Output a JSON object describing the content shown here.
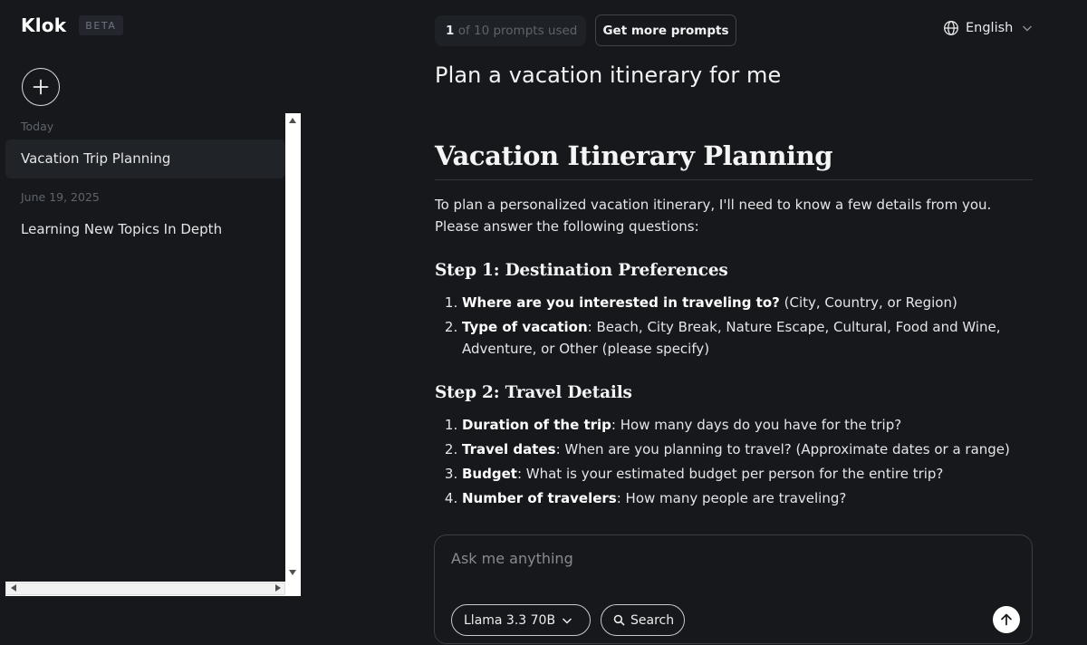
{
  "brand": {
    "name": "Klok",
    "badge": "BETA"
  },
  "sidebar": {
    "new_chat_icon": "plus-icon",
    "history": [
      {
        "group": "Today",
        "items": [
          {
            "label": "Vacation Trip Planning",
            "active": true
          }
        ]
      },
      {
        "group": "June 19, 2025",
        "items": [
          {
            "label": "Learning New Topics In Depth",
            "active": false
          }
        ]
      }
    ]
  },
  "topbar": {
    "usage_used": "1",
    "usage_rest": " of 10 prompts used",
    "more_prompts_label": "Get more prompts",
    "language": "English",
    "language_icon": "globe-icon"
  },
  "conversation": {
    "prompt": "Plan a vacation itinerary for me",
    "answer": {
      "title": "Vacation Itinerary Planning",
      "intro": "To plan a personalized vacation itinerary, I'll need to know a few details from you. Please answer the following questions:",
      "sections": [
        {
          "heading": "Step 1: Destination Preferences",
          "items": [
            {
              "bold": "Where are you interested in traveling to?",
              "text": " (City, Country, or Region)"
            },
            {
              "bold": "Type of vacation",
              "text": ": Beach, City Break, Nature Escape, Cultural, Food and Wine, Adventure, or Other (please specify)"
            }
          ]
        },
        {
          "heading": "Step 2: Travel Details",
          "items": [
            {
              "bold": "Duration of the trip",
              "text": ": How many days do you have for the trip?"
            },
            {
              "bold": "Travel dates",
              "text": ": When are you planning to travel? (Approximate dates or a range)"
            },
            {
              "bold": "Budget",
              "text": ": What is your estimated budget per person for the entire trip?"
            },
            {
              "bold": "Number of travelers",
              "text": ": How many people are traveling?"
            }
          ]
        }
      ]
    }
  },
  "composer": {
    "placeholder": "Ask me anything",
    "model_label": "Llama 3.3 70B",
    "search_label": "Search",
    "send_icon": "arrow-up-icon"
  },
  "colors": {
    "background": "#16181c",
    "active_item": "#202328",
    "muted_text": "#5f646c",
    "border": "#3a3e45"
  }
}
